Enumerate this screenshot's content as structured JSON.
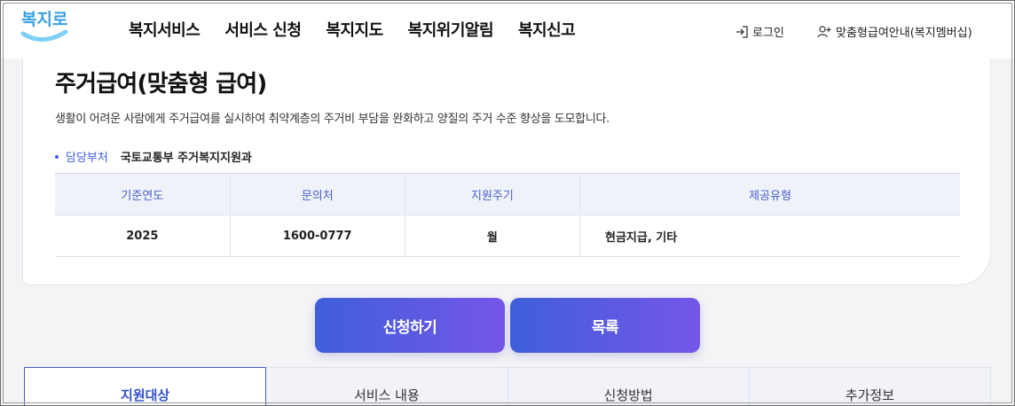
{
  "header": {
    "logo_text": "복지로",
    "nav": [
      "복지서비스",
      "서비스 신청",
      "복지지도",
      "복지위기알림",
      "복지신고"
    ],
    "login_label": "로그인",
    "member_label": "맞춤형급여안내(복지멤버십)"
  },
  "service": {
    "title": "주거급여(맞춤형 급여)",
    "description": "생활이 어려운 사람에게 주거급여를 실시하여 취약계층의 주거비 부담을 완화하고 양질의 주거 수준 향상을 도모합니다.",
    "dept_label": "담당부처",
    "dept_value": "국토교통부 주거복지지원과"
  },
  "info_table": {
    "headers": [
      "기준연도",
      "문의처",
      "지원주기",
      "제공유형"
    ],
    "row": [
      "2025",
      "1600-0777",
      "월",
      "현금지급, 기타"
    ]
  },
  "actions": {
    "apply_label": "신청하기",
    "list_label": "목록"
  },
  "tabs": [
    "지원대상",
    "서비스 내용",
    "신청방법",
    "추가정보"
  ],
  "colors": {
    "accent": "#3f5ee0",
    "button_gradient_start": "#3f5fd9",
    "button_gradient_end": "#7556e8",
    "table_header_bg": "#eff2f8"
  }
}
